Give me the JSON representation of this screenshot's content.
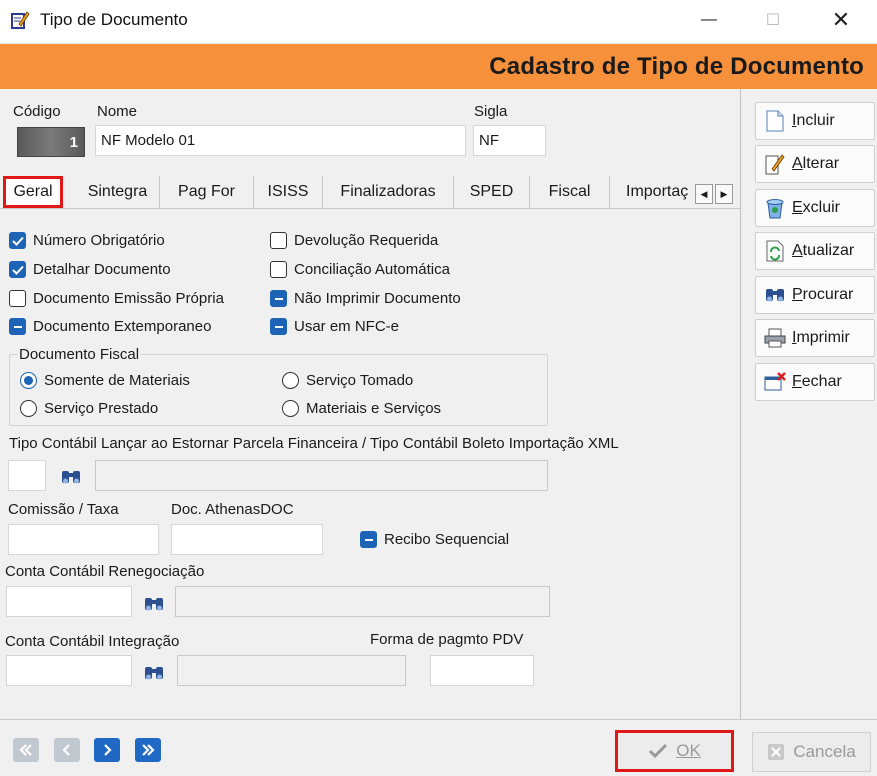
{
  "window": {
    "title": "Tipo de Documento",
    "minimize": "—",
    "maximize": "☐",
    "close": "✕"
  },
  "header": {
    "title": "Cadastro de Tipo de Documento"
  },
  "fields": {
    "codigo_label": "Código",
    "codigo_value": "1",
    "nome_label": "Nome",
    "nome_value": "NF Modelo 01",
    "sigla_label": "Sigla",
    "sigla_value": "NF"
  },
  "tabs": [
    "Geral",
    "Sintegra",
    "Pag For",
    "ISISS",
    "Finalizadoras",
    "SPED",
    "Fiscal",
    "Importaç"
  ],
  "tab_scroll": {
    "left": "◀",
    "right": "▶"
  },
  "checkboxes": {
    "numero_obrigatorio": "Número Obrigatório",
    "detalhar_documento": "Detalhar Documento",
    "documento_emissao_propria": "Documento Emissão Própria",
    "documento_extemporaneo": "Documento Extemporaneo",
    "devolucao_requerida": "Devolução Requerida",
    "conciliacao_automatica": "Conciliação Automática",
    "nao_imprimir_documento": "Não Imprimir Documento",
    "usar_em_nfce": "Usar em NFC-e",
    "recibo_sequencial": "Recibo Sequencial"
  },
  "documento_fiscal": {
    "title": "Documento Fiscal",
    "options": [
      "Somente de Materiais",
      "Serviço Tomado",
      "Serviço Prestado",
      "Materiais e Serviços"
    ],
    "selected": "Somente de Materiais"
  },
  "tipo_contabil_label": "Tipo Contábil Lançar ao Estornar Parcela Financeira / Tipo Contábil Boleto Importação XML",
  "comissao_label": "Comissão / Taxa",
  "athenas_label": "Doc. AthenasDOC",
  "renegociacao_label": "Conta Contábil Renegociação",
  "integracao_label": "Conta Contábil Integração",
  "forma_pagmto_label": "Forma de pagmto PDV",
  "side_buttons": [
    "Incluir",
    "Alterar",
    "Excluir",
    "Atualizar",
    "Procurar",
    "Imprimir",
    "Fechar"
  ],
  "bottom": {
    "ok": "OK",
    "cancel": "Cancela"
  },
  "colors": {
    "header": "#f7903a",
    "accent_blue": "#1d63b6",
    "highlight_red": "#e01818"
  }
}
